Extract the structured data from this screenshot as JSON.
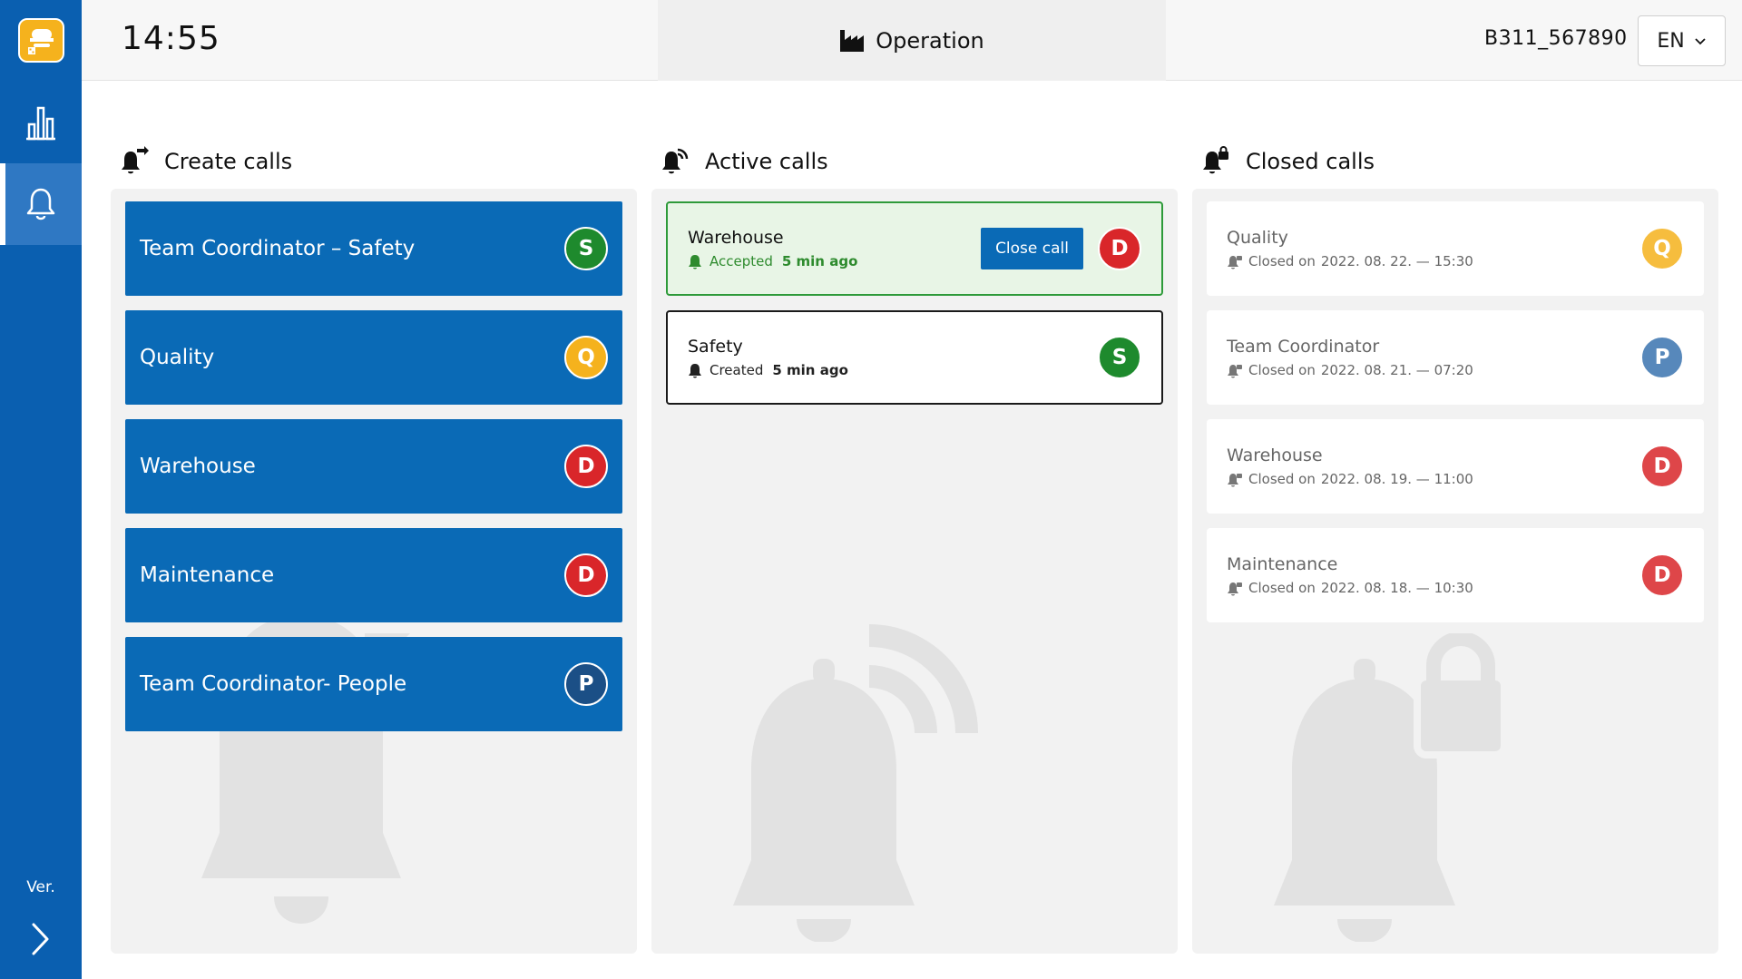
{
  "header": {
    "time": "14:55",
    "mode": "Operation",
    "device_id": "B311_567890",
    "language": "EN"
  },
  "sidebar": {
    "version_label": "Ver.",
    "items": [
      {
        "name": "statistics",
        "icon": "bar-chart-icon"
      },
      {
        "name": "calls",
        "icon": "bell-icon",
        "active": true
      }
    ]
  },
  "columns": {
    "create": {
      "title": "Create calls"
    },
    "active": {
      "title": "Active calls"
    },
    "closed": {
      "title": "Closed calls"
    }
  },
  "create_calls": [
    {
      "label": "Team Coordinator – Safety",
      "badge": "S",
      "badge_color": "#1e8a2d"
    },
    {
      "label": "Quality",
      "badge": "Q",
      "badge_color": "#f5b21d"
    },
    {
      "label": "Warehouse",
      "badge": "D",
      "badge_color": "#d9262a"
    },
    {
      "label": "Maintenance",
      "badge": "D",
      "badge_color": "#d9262a"
    },
    {
      "label": "Team Coordinator- People",
      "badge": "P",
      "badge_color": "#1b4f86"
    }
  ],
  "active_calls": [
    {
      "name": "Warehouse",
      "status": "Accepted",
      "time": "5 min ago",
      "action": "Close call",
      "badge": "D",
      "status_color": "#2e9a3a"
    },
    {
      "name": "Safety",
      "status": "Created",
      "time": "5 min ago",
      "badge": "S"
    }
  ],
  "closed_calls": [
    {
      "name": "Quality",
      "closed_label": "Closed on",
      "closed_at": "2022. 08. 22. — 15:30",
      "badge": "Q"
    },
    {
      "name": "Team Coordinator",
      "closed_label": "Closed on",
      "closed_at": "2022. 08. 21. — 07:20",
      "badge": "P"
    },
    {
      "name": "Warehouse",
      "closed_label": "Closed on",
      "closed_at": "2022. 08. 19. — 11:00",
      "badge": "D"
    },
    {
      "name": "Maintenance",
      "closed_label": "Closed on",
      "closed_at": "2022. 08. 18. — 10:30",
      "badge": "D"
    }
  ],
  "colors": {
    "primary": "#0a6ab6",
    "sidebar": "#0a5fb0",
    "accepted": "#2e9a3a",
    "safety": "#1e8a2d",
    "quality": "#f5b21d",
    "department": "#d9262a",
    "people": "#1b4f86"
  }
}
